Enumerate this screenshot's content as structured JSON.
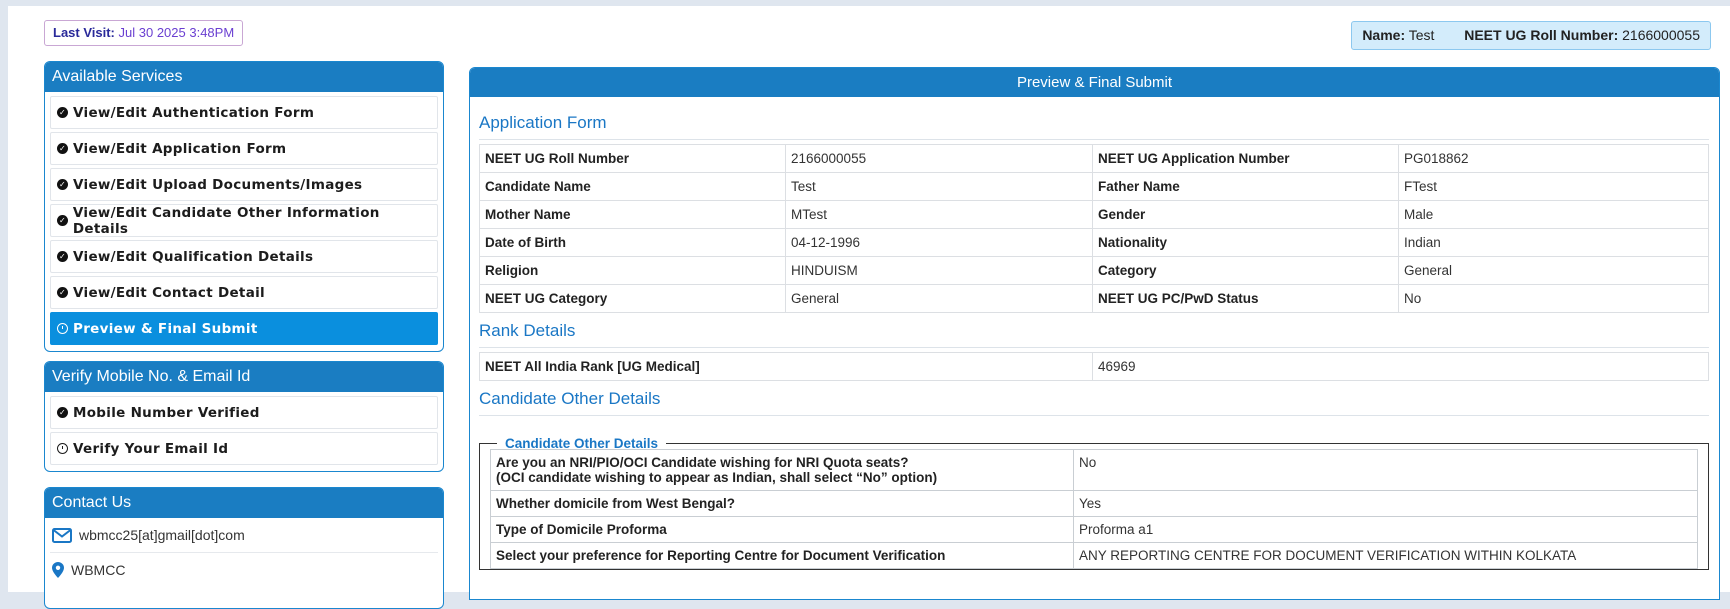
{
  "header": {
    "last_visit_label": "Last Visit:",
    "last_visit_value": "Jul 30 2025 3:48PM",
    "name_label": "Name:",
    "name_value": "Test",
    "roll_label": "NEET UG Roll Number:",
    "roll_value": "2166000055"
  },
  "services": {
    "title": "Available Services",
    "items": [
      {
        "label": "View/Edit Authentication Form",
        "icon": "check-circle-icon",
        "active": false
      },
      {
        "label": "View/Edit Application Form",
        "icon": "check-circle-icon",
        "active": false
      },
      {
        "label": "View/Edit Upload Documents/Images",
        "icon": "check-circle-icon",
        "active": false
      },
      {
        "label": "View/Edit Candidate Other Information Details",
        "icon": "check-circle-icon",
        "active": false
      },
      {
        "label": "View/Edit Qualification Details",
        "icon": "check-circle-icon",
        "active": false
      },
      {
        "label": "View/Edit Contact Detail",
        "icon": "check-circle-icon",
        "active": false
      },
      {
        "label": "Preview & Final Submit",
        "icon": "clock-icon",
        "active": true
      }
    ]
  },
  "verify": {
    "title": "Verify Mobile No. & Email Id",
    "items": [
      {
        "label": "Mobile Number Verified",
        "icon": "check-circle-icon"
      },
      {
        "label": "Verify Your Email Id",
        "icon": "clock-icon"
      }
    ]
  },
  "contact": {
    "title": "Contact Us",
    "email": "wbmcc25[at]gmail[dot]com",
    "location": "WBMCC"
  },
  "main": {
    "title": "Preview & Final Submit",
    "application_form": {
      "title": "Application Form",
      "rows": [
        [
          "NEET UG Roll Number",
          "2166000055",
          "NEET UG Application Number",
          "PG018862"
        ],
        [
          "Candidate Name",
          "Test",
          "Father Name",
          "FTest"
        ],
        [
          "Mother Name",
          "MTest",
          "Gender",
          "Male"
        ],
        [
          "Date of Birth",
          "04-12-1996",
          "Nationality",
          "Indian"
        ],
        [
          "Religion",
          "HINDUISM",
          "Category",
          "General"
        ],
        [
          "NEET UG Category",
          "General",
          "NEET UG PC/PwD Status",
          "No"
        ]
      ]
    },
    "rank_details": {
      "title": "Rank Details",
      "label": "NEET All India Rank [UG Medical]",
      "value": "46969"
    },
    "candidate_other": {
      "title": "Candidate Other Details",
      "legend": "Candidate Other Details",
      "rows": [
        {
          "q1": "Are you an NRI/PIO/OCI Candidate wishing for NRI Quota seats?",
          "q2": "(OCI candidate wishing to appear as Indian, shall select “No” option)",
          "a": "No"
        },
        {
          "q1": "Whether domicile from West Bengal?",
          "q2": "",
          "a": "Yes"
        },
        {
          "q1": "Type of Domicile Proforma",
          "q2": "",
          "a": "Proforma a1"
        },
        {
          "q1": "Select your preference for Reporting Centre for Document Verification",
          "q2": "",
          "a": "ANY REPORTING CENTRE FOR DOCUMENT VERIFICATION WITHIN KOLKATA"
        }
      ]
    }
  },
  "colors": {
    "header_blue": "#1a7dc2",
    "active_blue": "#0a8fde",
    "section_title": "#1a77c5",
    "name_box_bg": "#d3ecfb"
  }
}
